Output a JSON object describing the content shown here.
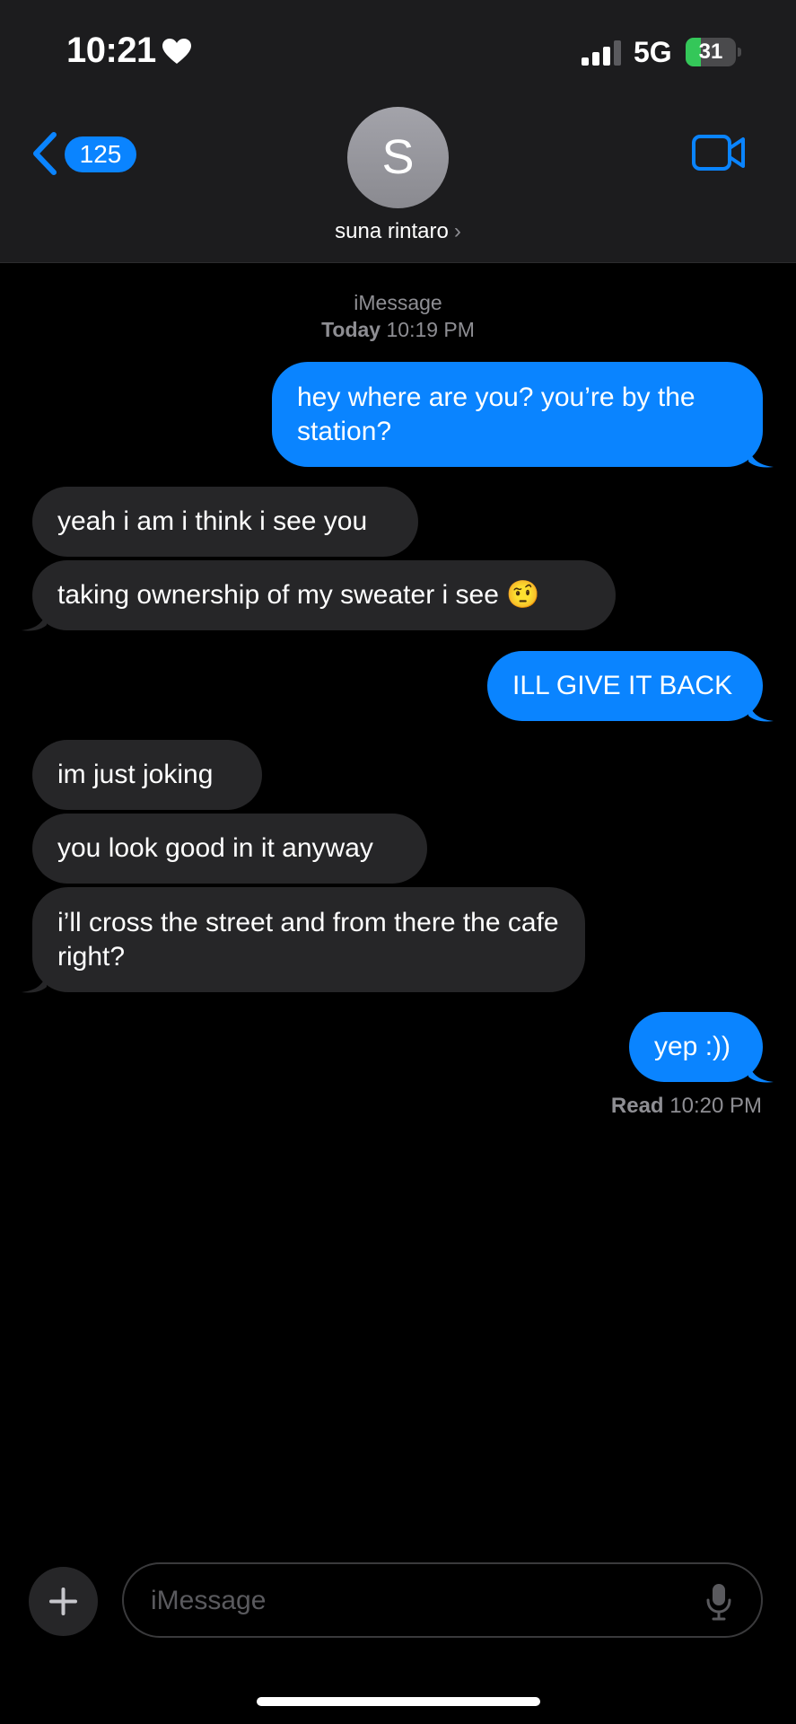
{
  "status_bar": {
    "time": "10:21",
    "network": "5G",
    "battery_level": "31",
    "battery_fraction": 0.31,
    "heart_icon": "heart-icon",
    "signal_icon": "cellular-signal-icon"
  },
  "nav": {
    "back_count": "125",
    "avatar_initial": "S",
    "contact_name": "suna rintaro",
    "name_chevron": "›",
    "video_icon": "video-camera-icon"
  },
  "thread": {
    "service": "iMessage",
    "day": "Today",
    "time": "10:19 PM"
  },
  "messages": [
    {
      "direction": "out",
      "text": "hey where are you? you’re by the station?"
    },
    {
      "direction": "in",
      "text": "yeah i am i think i see you"
    },
    {
      "direction": "in",
      "text": "taking ownership of my sweater i see 🤨"
    },
    {
      "direction": "out",
      "text": "ILL GIVE IT BACK"
    },
    {
      "direction": "in",
      "text": "im just joking"
    },
    {
      "direction": "in",
      "text": "you look good in it anyway"
    },
    {
      "direction": "in",
      "text": "i’ll cross the street and from there the cafe right?"
    },
    {
      "direction": "out",
      "text": "yep :))"
    }
  ],
  "read_receipt": {
    "label": "Read",
    "time": "10:20 PM"
  },
  "composer": {
    "placeholder": "iMessage",
    "plus_icon": "plus-icon",
    "mic_icon": "microphone-icon"
  },
  "colors": {
    "accent": "#0a84ff",
    "incoming_bubble": "#262628",
    "header_bg": "#1c1c1e",
    "battery_green": "#34c759"
  }
}
